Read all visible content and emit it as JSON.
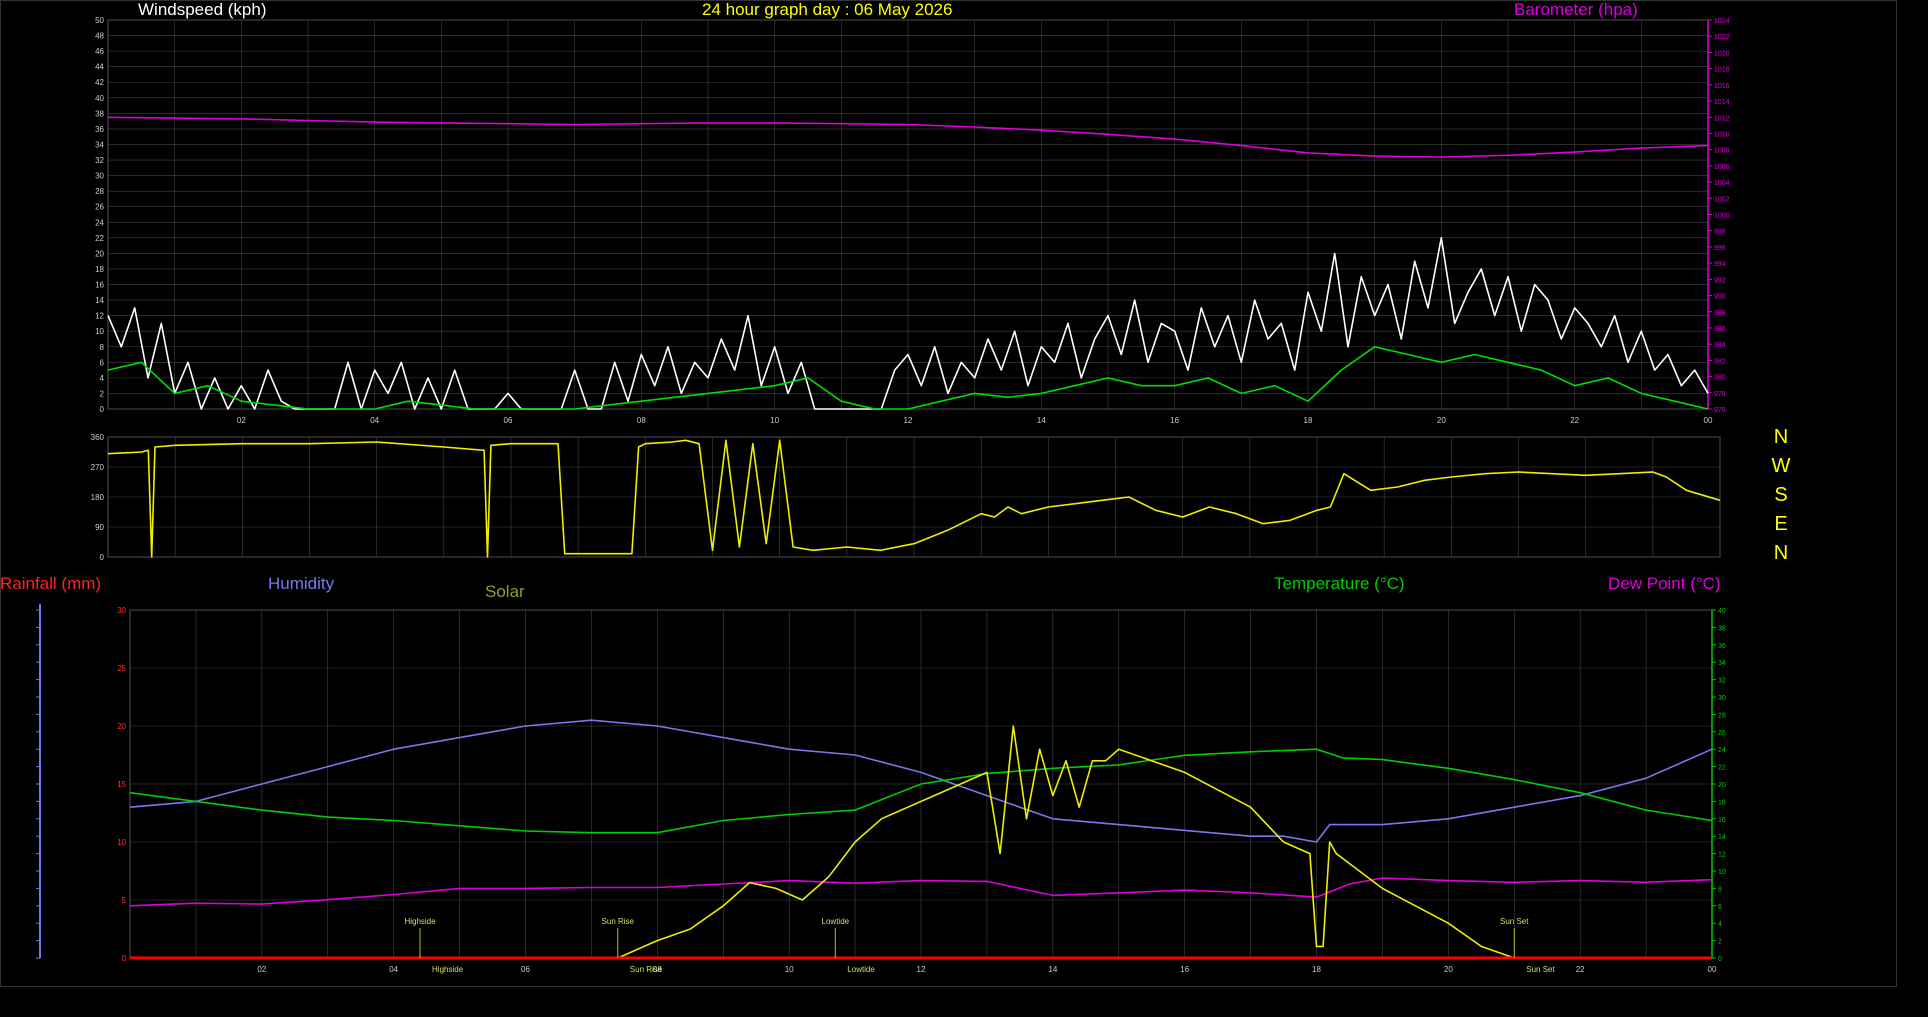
{
  "title": "24 hour graph day : 06 May 2026",
  "colors": {
    "background": "#000000",
    "grid": "#444444",
    "windspeed": "#ffffff",
    "gust_avg": "#00dd00",
    "barometer": "#dd00dd",
    "direction": "#eeee00",
    "rainfall": "#ff0000",
    "humidity": "#7777ee",
    "solar": "#eeee00",
    "temperature": "#00cc00",
    "dewpoint": "#dd00dd",
    "title": "#ffff00"
  },
  "compass": [
    "N",
    "W",
    "S",
    "E",
    "N"
  ],
  "chart_data": [
    {
      "type": "line",
      "name": "wind-panel",
      "ylabel": "Windspeed (kph)",
      "y2label": "Barometer (hpa)",
      "ylim": [
        0,
        50
      ],
      "y2lim": [
        976,
        1024
      ],
      "xlim": [
        0,
        24
      ],
      "x_ticks": [
        "02",
        "04",
        "06",
        "08",
        "10",
        "12",
        "14",
        "16",
        "18",
        "20",
        "22",
        "00"
      ],
      "y_ticks": [
        "0",
        "2",
        "4",
        "6",
        "8",
        "10",
        "12",
        "14",
        "16",
        "18",
        "20",
        "22",
        "24",
        "26",
        "28",
        "30",
        "32",
        "34",
        "36",
        "38",
        "40",
        "42",
        "44",
        "46",
        "48",
        "50"
      ],
      "y2_ticks": [
        "976",
        "978",
        "980",
        "982",
        "984",
        "986",
        "988",
        "990",
        "992",
        "994",
        "996",
        "998",
        "1000",
        "1002",
        "1004",
        "1006",
        "1008",
        "1010",
        "1012",
        "1014",
        "1016",
        "1018",
        "1020",
        "1022",
        "1024"
      ],
      "grid": true,
      "series": [
        {
          "key": "barometer",
          "x": [
            0,
            1,
            2,
            3,
            4,
            5,
            6,
            7,
            8,
            9,
            10,
            11,
            12,
            13,
            14,
            15,
            16,
            17,
            18,
            19,
            20,
            21,
            22,
            23,
            24
          ],
          "values": [
            1012,
            1011.9,
            1011.8,
            1011.6,
            1011.4,
            1011.3,
            1011.2,
            1011.1,
            1011.2,
            1011.3,
            1011.3,
            1011.2,
            1011.1,
            1010.8,
            1010.4,
            1009.9,
            1009.3,
            1008.5,
            1007.6,
            1007.2,
            1007.1,
            1007.3,
            1007.7,
            1008.2,
            1008.5
          ]
        },
        {
          "key": "windspeed",
          "x": [
            0,
            0.2,
            0.4,
            0.6,
            0.8,
            1,
            1.2,
            1.4,
            1.6,
            1.8,
            2,
            2.2,
            2.4,
            2.6,
            2.8,
            3,
            3.2,
            3.4,
            3.6,
            3.8,
            4,
            4.2,
            4.4,
            4.6,
            4.8,
            5,
            5.2,
            5.4,
            5.6,
            5.8,
            6,
            6.2,
            6.4,
            6.6,
            6.8,
            7,
            7.2,
            7.4,
            7.6,
            7.8,
            8,
            8.2,
            8.4,
            8.6,
            8.8,
            9,
            9.2,
            9.4,
            9.6,
            9.8,
            10,
            10.2,
            10.4,
            10.6,
            10.8,
            11,
            11.2,
            11.4,
            11.6,
            11.8,
            12,
            12.2,
            12.4,
            12.6,
            12.8,
            13,
            13.2,
            13.4,
            13.6,
            13.8,
            14,
            14.2,
            14.4,
            14.6,
            14.8,
            15,
            15.2,
            15.4,
            15.6,
            15.8,
            16,
            16.2,
            16.4,
            16.6,
            16.8,
            17,
            17.2,
            17.4,
            17.6,
            17.8,
            18,
            18.2,
            18.4,
            18.6,
            18.8,
            19,
            19.2,
            19.4,
            19.6,
            19.8,
            20,
            20.2,
            20.4,
            20.6,
            20.8,
            21,
            21.2,
            21.4,
            21.6,
            21.8,
            22,
            22.2,
            22.4,
            22.6,
            22.8,
            23,
            23.2,
            23.4,
            23.6,
            23.8,
            24
          ],
          "values": [
            12,
            8,
            13,
            4,
            11,
            2,
            6,
            0,
            4,
            0,
            3,
            0,
            5,
            1,
            0,
            0,
            0,
            0,
            6,
            0,
            5,
            2,
            6,
            0,
            4,
            0,
            5,
            0,
            0,
            0,
            2,
            0,
            0,
            0,
            0,
            5,
            0,
            0,
            6,
            1,
            7,
            3,
            8,
            2,
            6,
            4,
            9,
            5,
            12,
            3,
            8,
            2,
            6,
            0,
            0,
            0,
            0,
            0,
            0,
            5,
            7,
            3,
            8,
            2,
            6,
            4,
            9,
            5,
            10,
            3,
            8,
            6,
            11,
            4,
            9,
            12,
            7,
            14,
            6,
            11,
            10,
            5,
            13,
            8,
            12,
            6,
            14,
            9,
            11,
            5,
            15,
            10,
            20,
            8,
            17,
            12,
            16,
            9,
            19,
            13,
            22,
            11,
            15,
            18,
            12,
            17,
            10,
            16,
            14,
            9,
            13,
            11,
            8,
            12,
            6,
            10,
            5,
            7,
            3,
            5,
            2
          ]
        },
        {
          "key": "gust_avg",
          "x": [
            0,
            0.5,
            1,
            1.5,
            2,
            2.5,
            3,
            3.5,
            4,
            4.5,
            5,
            5.5,
            6,
            6.5,
            7,
            7.5,
            8,
            8.5,
            9,
            9.5,
            10,
            10.5,
            11,
            11.5,
            12,
            12.5,
            13,
            13.5,
            14,
            14.5,
            15,
            15.5,
            16,
            16.5,
            17,
            17.5,
            18,
            18.5,
            19,
            19.5,
            20,
            20.5,
            21,
            21.5,
            22,
            22.5,
            23,
            23.5,
            24
          ],
          "values": [
            5,
            6,
            2,
            3,
            1,
            0.5,
            0,
            0,
            0,
            1,
            0.5,
            0,
            0,
            0,
            0,
            0.5,
            1,
            1.5,
            2,
            2.5,
            3,
            4,
            1,
            0,
            0,
            1,
            2,
            1.5,
            2,
            3,
            4,
            3,
            3,
            4,
            2,
            3,
            1,
            5,
            8,
            7,
            6,
            7,
            6,
            5,
            3,
            4,
            2,
            1,
            0
          ]
        }
      ]
    },
    {
      "type": "line",
      "name": "direction-panel",
      "ylim": [
        0,
        360
      ],
      "xlim": [
        0,
        24
      ],
      "y_ticks": [
        "0",
        "90",
        "180",
        "270",
        "360"
      ],
      "grid": true,
      "series": [
        {
          "key": "direction",
          "x": [
            0,
            0.5,
            0.6,
            0.65,
            0.7,
            1,
            2,
            3,
            4,
            5,
            5.6,
            5.65,
            5.7,
            6,
            6.7,
            6.8,
            7,
            7.8,
            7.9,
            8,
            8.4,
            8.6,
            8.8,
            9,
            9.2,
            9.4,
            9.6,
            9.8,
            10,
            10.2,
            10.5,
            11,
            11.5,
            12,
            12.5,
            13,
            13.2,
            13.4,
            13.6,
            14,
            14.4,
            14.8,
            15.2,
            15.6,
            16,
            16.4,
            16.8,
            17.2,
            17.6,
            18,
            18.2,
            18.4,
            18.8,
            19.2,
            19.6,
            20,
            20.5,
            21,
            21.5,
            22,
            22.5,
            23,
            23.2,
            23.5,
            24
          ],
          "values": [
            310,
            315,
            320,
            0,
            330,
            335,
            340,
            340,
            345,
            330,
            320,
            0,
            335,
            340,
            340,
            10,
            10,
            10,
            330,
            340,
            345,
            350,
            340,
            20,
            350,
            30,
            340,
            40,
            350,
            30,
            20,
            30,
            20,
            40,
            80,
            130,
            120,
            150,
            130,
            150,
            160,
            170,
            180,
            140,
            120,
            150,
            130,
            100,
            110,
            140,
            150,
            250,
            200,
            210,
            230,
            240,
            250,
            255,
            250,
            245,
            250,
            255,
            240,
            200,
            170
          ]
        }
      ]
    },
    {
      "type": "line",
      "name": "climate-panel",
      "labels": {
        "rainfall": "Rainfall (mm)",
        "humidity": "Humidity",
        "solar": "Solar",
        "temperature": "Temperature (°C)",
        "dewpoint": "Dew Point (°C)"
      },
      "ylim": [
        0,
        30
      ],
      "y2lim": [
        0,
        40
      ],
      "xlim": [
        0,
        24
      ],
      "x_ticks": [
        "02",
        "04",
        "06",
        "08",
        "10",
        "12",
        "14",
        "16",
        "18",
        "20",
        "22",
        "00"
      ],
      "y_ticks": [
        "0",
        "5",
        "10",
        "15",
        "20",
        "25",
        "30"
      ],
      "y2_ticks": [
        "0",
        "2",
        "4",
        "6",
        "8",
        "10",
        "12",
        "14",
        "16",
        "18",
        "20",
        "22",
        "24",
        "26",
        "28",
        "30",
        "32",
        "34",
        "36",
        "38",
        "40"
      ],
      "events": [
        {
          "x": 4.4,
          "label": "Highside"
        },
        {
          "x": 7.4,
          "label": "Sun Rise"
        },
        {
          "x": 10.7,
          "label": "Lowtide"
        },
        {
          "x": 21.0,
          "label": "Sun Set"
        }
      ],
      "grid": true,
      "series": [
        {
          "key": "humidity",
          "x": [
            0,
            1,
            2,
            3,
            4,
            5,
            6,
            7,
            8,
            9,
            10,
            11,
            12,
            13,
            14,
            15,
            16,
            17,
            17.5,
            18,
            18.2,
            19,
            20,
            21,
            22,
            23,
            24
          ],
          "values": [
            13,
            13.5,
            15,
            16.5,
            18,
            19,
            20,
            20.5,
            20,
            19,
            18,
            17.5,
            16,
            14,
            12,
            11.5,
            11,
            10.5,
            10.5,
            10,
            11.5,
            11.5,
            12,
            13,
            14,
            15.5,
            18
          ]
        },
        {
          "key": "temperature",
          "x": [
            0,
            1,
            2,
            3,
            4,
            5,
            6,
            7,
            8,
            9,
            10,
            11,
            12,
            13,
            14,
            15,
            16,
            17,
            18,
            18.4,
            19,
            20,
            21,
            22,
            23,
            24
          ],
          "values": [
            19,
            18,
            17,
            16.2,
            15.8,
            15.2,
            14.6,
            14.4,
            14.4,
            15.8,
            16.5,
            17,
            20,
            21.2,
            21.8,
            22.2,
            23.3,
            23.7,
            24,
            23,
            22.8,
            21.8,
            20.5,
            19,
            17,
            15.8
          ]
        },
        {
          "key": "dewpoint",
          "x": [
            0,
            1,
            2,
            3,
            4,
            5,
            6,
            7,
            8,
            9,
            10,
            11,
            12,
            13,
            14,
            15,
            16,
            17,
            18,
            18.5,
            19,
            20,
            21,
            22,
            23,
            24
          ],
          "values": [
            6,
            6.3,
            6.2,
            6.7,
            7.3,
            8,
            8,
            8.1,
            8.1,
            8.5,
            8.9,
            8.6,
            8.9,
            8.8,
            7.2,
            7.5,
            7.8,
            7.5,
            7,
            8.5,
            9.2,
            8.9,
            8.7,
            8.9,
            8.7,
            9
          ]
        },
        {
          "key": "solar",
          "x": [
            7.4,
            8,
            8.5,
            9,
            9.4,
            9.8,
            10.2,
            10.6,
            11,
            11.4,
            11.8,
            12.2,
            12.6,
            13,
            13.2,
            13.4,
            13.6,
            13.8,
            14,
            14.2,
            14.4,
            14.6,
            14.8,
            15,
            16,
            17,
            17.5,
            17.9,
            18,
            18.1,
            18.2,
            18.3,
            19,
            20,
            20.5,
            21,
            21.5,
            24
          ],
          "values": [
            0,
            1.5,
            2.5,
            4.5,
            6.5,
            6,
            5,
            7,
            10,
            12,
            13,
            14,
            15,
            16,
            9,
            20,
            12,
            18,
            14,
            17,
            13,
            17,
            17,
            18,
            16,
            13,
            10,
            9,
            1,
            1,
            10,
            9,
            6,
            3,
            1,
            0,
            0,
            0
          ]
        },
        {
          "key": "rainfall",
          "x": [
            0,
            24
          ],
          "values": [
            0,
            0
          ]
        }
      ]
    }
  ]
}
